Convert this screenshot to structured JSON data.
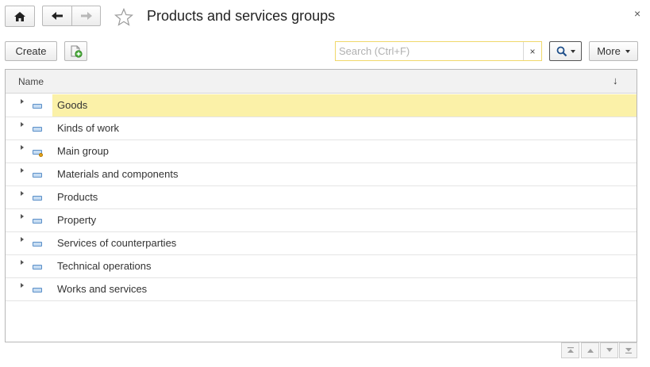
{
  "window": {
    "title": "Products and services groups",
    "close_label": "×"
  },
  "toolbar": {
    "create_label": "Create",
    "more_label": "More",
    "search_placeholder": "Search (Ctrl+F)",
    "search_value": "",
    "search_clear_label": "×"
  },
  "grid": {
    "column_name": "Name",
    "sort_indicator": "↓",
    "rows": [
      {
        "label": "Goods",
        "selected": true,
        "has_mark": false
      },
      {
        "label": "Kinds of work",
        "selected": false,
        "has_mark": false
      },
      {
        "label": "Main group",
        "selected": false,
        "has_mark": true
      },
      {
        "label": "Materials and components",
        "selected": false,
        "has_mark": false
      },
      {
        "label": "Products",
        "selected": false,
        "has_mark": false
      },
      {
        "label": "Property",
        "selected": false,
        "has_mark": false
      },
      {
        "label": "Services of counterparties",
        "selected": false,
        "has_mark": false
      },
      {
        "label": "Technical operations",
        "selected": false,
        "has_mark": false
      },
      {
        "label": "Works and services",
        "selected": false,
        "has_mark": false
      }
    ]
  },
  "icons": {
    "home": "home-icon",
    "back": "arrow-left-icon",
    "forward": "arrow-right-icon",
    "favorite": "star-icon",
    "create_copy": "add-document-icon",
    "search": "search-icon",
    "nav_first": "first-page-icon",
    "nav_prev": "prev-page-icon",
    "nav_next": "next-page-icon",
    "nav_last": "last-page-icon"
  },
  "colors": {
    "selection": "#fbf1a8",
    "search_border": "#f0d86a",
    "folder_blue": "#5a8fc8"
  }
}
